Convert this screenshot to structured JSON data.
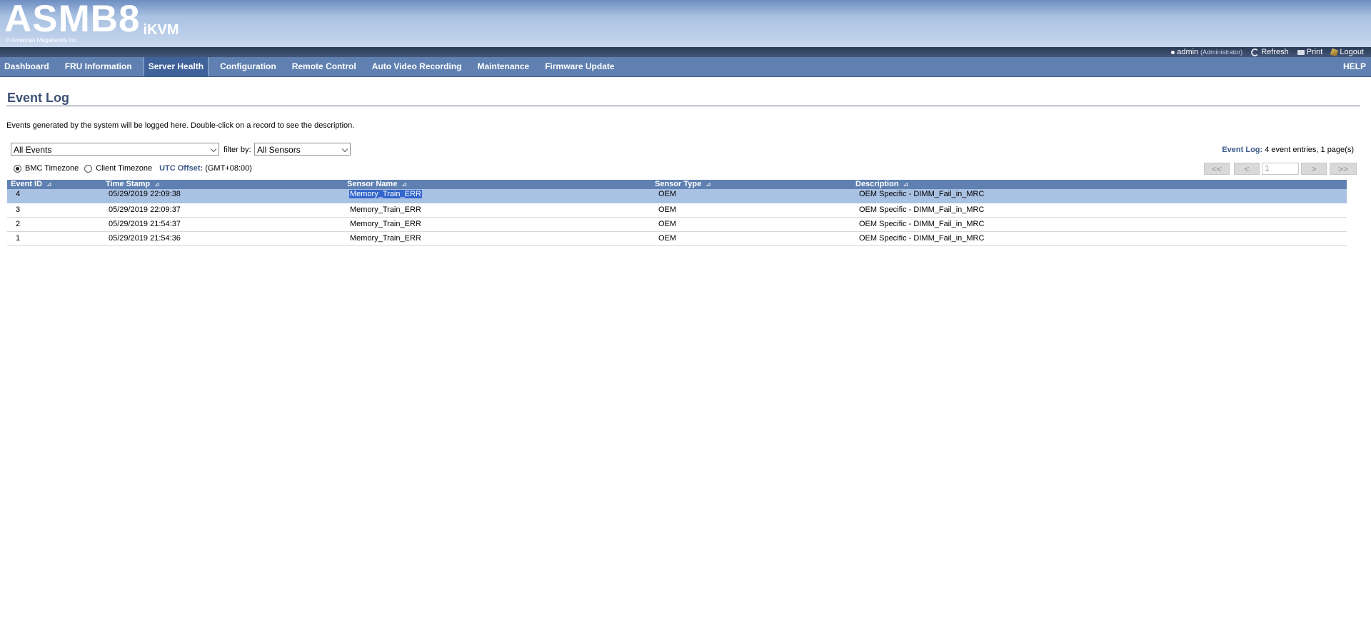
{
  "brand": {
    "logo_main": "ASMB8",
    "logo_sub": "iKVM",
    "copyright": "© American Megatrends Inc."
  },
  "user_bar": {
    "username": "admin",
    "role": "(Administrator)",
    "refresh_label": "Refresh",
    "print_label": "Print",
    "logout_label": "Logout"
  },
  "nav": {
    "items": [
      {
        "label": "Dashboard"
      },
      {
        "label": "FRU Information"
      },
      {
        "label": "Server Health"
      },
      {
        "label": "Configuration"
      },
      {
        "label": "Remote Control"
      },
      {
        "label": "Auto Video Recording"
      },
      {
        "label": "Maintenance"
      },
      {
        "label": "Firmware Update"
      }
    ],
    "active_index": 2,
    "help_label": "HELP"
  },
  "page": {
    "title": "Event Log",
    "description": "Events generated by the system will be logged here. Double-click on a record to see the description."
  },
  "filters": {
    "event_type_selected": "All Events",
    "filter_by_label": "filter by:",
    "sensor_selected": "All Sensors"
  },
  "summary": {
    "label": "Event Log:",
    "text": "4 event entries, 1 page(s)"
  },
  "timezone": {
    "bmc_label": "BMC Timezone",
    "client_label": "Client Timezone",
    "selected": "bmc",
    "utc_label": "UTC Offset:",
    "utc_value": "(GMT+08:00)"
  },
  "pager": {
    "first": "<<",
    "prev": "<",
    "page": "1",
    "next": ">",
    "last": ">>"
  },
  "table": {
    "headers": {
      "event_id": "Event ID",
      "timestamp": "Time Stamp",
      "sensor_name": "Sensor Name",
      "sensor_type": "Sensor Type",
      "description": "Description"
    },
    "sort_icon": "sort-icon",
    "rows": [
      {
        "event_id": "4",
        "timestamp": "05/29/2019 22:09:38",
        "sensor_name": "Memory_Train_ERR",
        "sensor_type": "OEM",
        "description": "OEM Specific - DIMM_Fail_in_MRC",
        "selected": true
      },
      {
        "event_id": "3",
        "timestamp": "05/29/2019 22:09:37",
        "sensor_name": "Memory_Train_ERR",
        "sensor_type": "OEM",
        "description": "OEM Specific - DIMM_Fail_in_MRC",
        "selected": false
      },
      {
        "event_id": "2",
        "timestamp": "05/29/2019 21:54:37",
        "sensor_name": "Memory_Train_ERR",
        "sensor_type": "OEM",
        "description": "OEM Specific - DIMM_Fail_in_MRC",
        "selected": false
      },
      {
        "event_id": "1",
        "timestamp": "05/29/2019 21:54:36",
        "sensor_name": "Memory_Train_ERR",
        "sensor_type": "OEM",
        "description": "OEM Specific - DIMM_Fail_in_MRC",
        "selected": false
      }
    ]
  },
  "colors": {
    "nav_bg": "#5f80b1",
    "nav_active": "#3f629a",
    "selected_row": "#a9c1e2",
    "title_text": "#3d5277",
    "text_highlight": "#3366cc"
  }
}
